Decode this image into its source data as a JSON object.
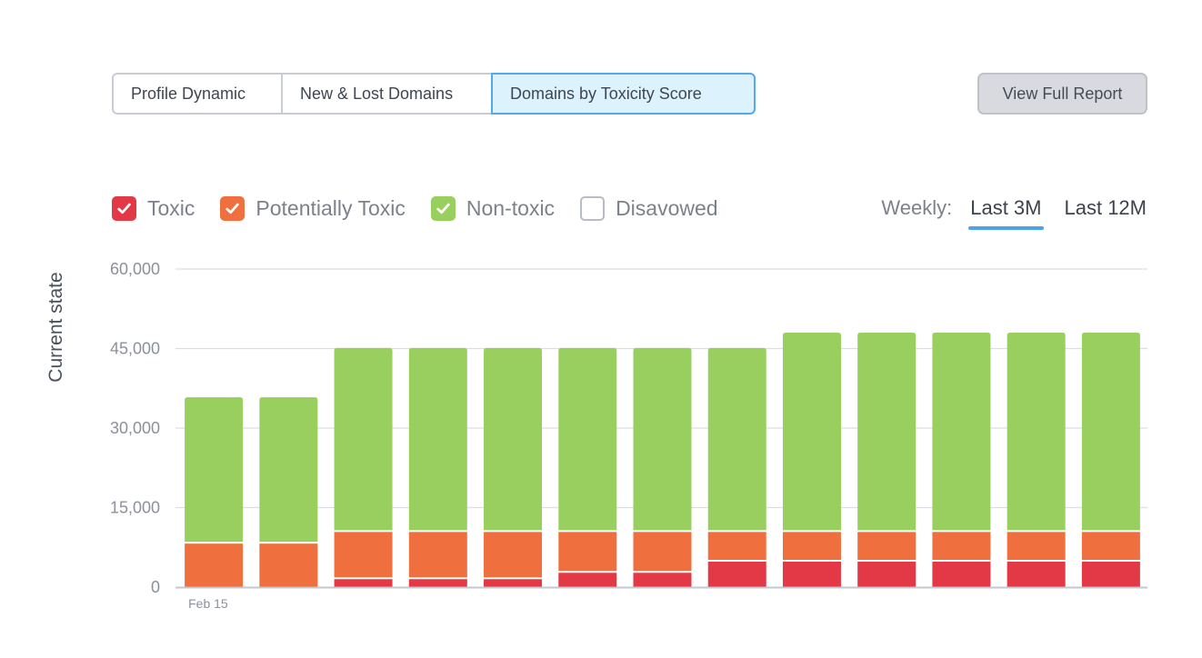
{
  "tabs": [
    {
      "label": "Profile Dynamic",
      "active": false
    },
    {
      "label": "New & Lost Domains",
      "active": false
    },
    {
      "label": "Domains by Toxicity Score",
      "active": true
    }
  ],
  "report_button": {
    "label": "View Full Report"
  },
  "legend": [
    {
      "label": "Toxic",
      "checked": true,
      "color": "#e33946"
    },
    {
      "label": "Potentially Toxic",
      "checked": true,
      "color": "#ef6f3f"
    },
    {
      "label": "Non-toxic",
      "checked": true,
      "color": "#98cf5f"
    },
    {
      "label": "Disavowed",
      "checked": false,
      "color": "#b8bcc4"
    }
  ],
  "period": {
    "label": "Weekly:",
    "options": [
      {
        "label": "Last 3M",
        "active": true
      },
      {
        "label": "Last 12M",
        "active": false
      }
    ]
  },
  "chart_data": {
    "type": "bar",
    "stacked": true,
    "title": "",
    "xlabel": "",
    "ylabel": "Current state",
    "ylim": [
      0,
      60000
    ],
    "yticks": [
      0,
      15000,
      30000,
      45000,
      60000
    ],
    "ytick_labels": [
      "0",
      "15,000",
      "30,000",
      "45,000",
      "60,000"
    ],
    "grid": true,
    "categories": [
      "Feb 15",
      "",
      "",
      "",
      "",
      "",
      "",
      "",
      "",
      "",
      "",
      "",
      ""
    ],
    "series": [
      {
        "name": "Toxic",
        "color": "#e33946",
        "values": [
          0,
          0,
          1500,
          1500,
          1500,
          2700,
          2700,
          4800,
          4800,
          4800,
          4800,
          4800,
          4800
        ]
      },
      {
        "name": "Potentially Toxic",
        "color": "#ef6f3f",
        "values": [
          8200,
          8200,
          8900,
          8900,
          8900,
          7700,
          7700,
          5600,
          5600,
          5600,
          5600,
          5600,
          5600
        ]
      },
      {
        "name": "Non-toxic",
        "color": "#98cf5f",
        "values": [
          27600,
          27600,
          34700,
          34700,
          34700,
          34700,
          34700,
          34700,
          37600,
          37600,
          37600,
          37600,
          37600
        ]
      }
    ]
  }
}
